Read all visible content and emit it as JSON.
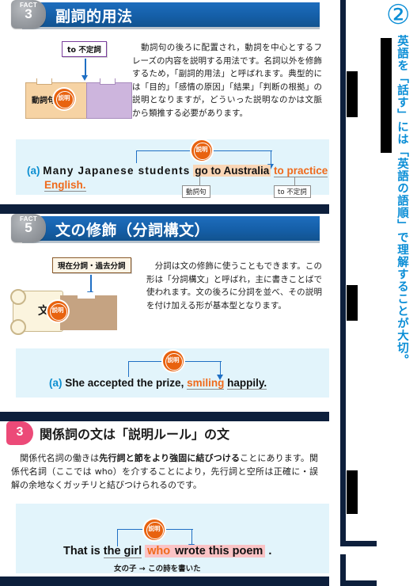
{
  "sections": [
    {
      "kicker": "FACT",
      "number": "3",
      "title": "副詞的用法",
      "body": "　動詞句の後ろに配置され，動詞を中心とするフレーズの内容を説明する用法です。名詞以外を修飾するため，「副詞的用法」と呼ばれます。典型的には「目的」「感情の原因」「結果」「判断の根拠」の説明となりますが，どういった説明なのかは文脈から類推する必要があります。",
      "diagram": {
        "tag_label": "to 不定詞",
        "block_label": "動詞句",
        "badge_label": "説明"
      },
      "example": {
        "marker": "(a)",
        "part1": "Many Japanese students",
        "part2": "go to Australia",
        "part3": "to practice",
        "part4": "English.",
        "badge_label": "説明",
        "tag_left": "動詞句",
        "tag_right": "to 不定詞"
      }
    },
    {
      "kicker": "FACT",
      "number": "5",
      "title": "文の修飾（分詞構文）",
      "body": "　分詞は文の修飾に使うこともできます。この形は「分詞構文」と呼ばれ，主に書きことばで使われます。文の後ろに分詞を並べ、その説明を付け加える形が基本型となります。",
      "diagram": {
        "tag_label": "現在分詞・過去分詞",
        "scroll_label": "文",
        "badge_label": "説明"
      },
      "example": {
        "marker": "(a)",
        "part1": "She accepted the prize,",
        "part2": "smiling",
        "part3": "happily.",
        "badge_label": "説明"
      }
    },
    {
      "number": "3",
      "title": "関係詞の文は「説明ルール」の文",
      "body_pre": "　関係代名詞の働きは",
      "body_bold": "先行詞と節をより強固に結びつける",
      "body_post": "ことにあります。関係代名詞（ここでは who）を介することにより，先行詞と空所は正確に・誤解の余地なくガッチリと結びつけられるのです。",
      "example": {
        "part1": "That is",
        "part2": "the girl",
        "part3": "who",
        "part4": "wrote this poem",
        "part5": ".",
        "badge_label": "説明",
        "note": "女の子 → この詩を書いた"
      }
    }
  ],
  "rail": {
    "circled_number": "②",
    "vertical_text": "英語を「話す」には「英語の語順」で理解することが大切。"
  },
  "colors": {
    "header_blue": "#1964b0",
    "navy": "#0d1f3c",
    "orange": "#e8620f",
    "pink": "#ec4a78",
    "example_bg": "#e2f4fb",
    "cyan_text": "#0b8ed6"
  }
}
